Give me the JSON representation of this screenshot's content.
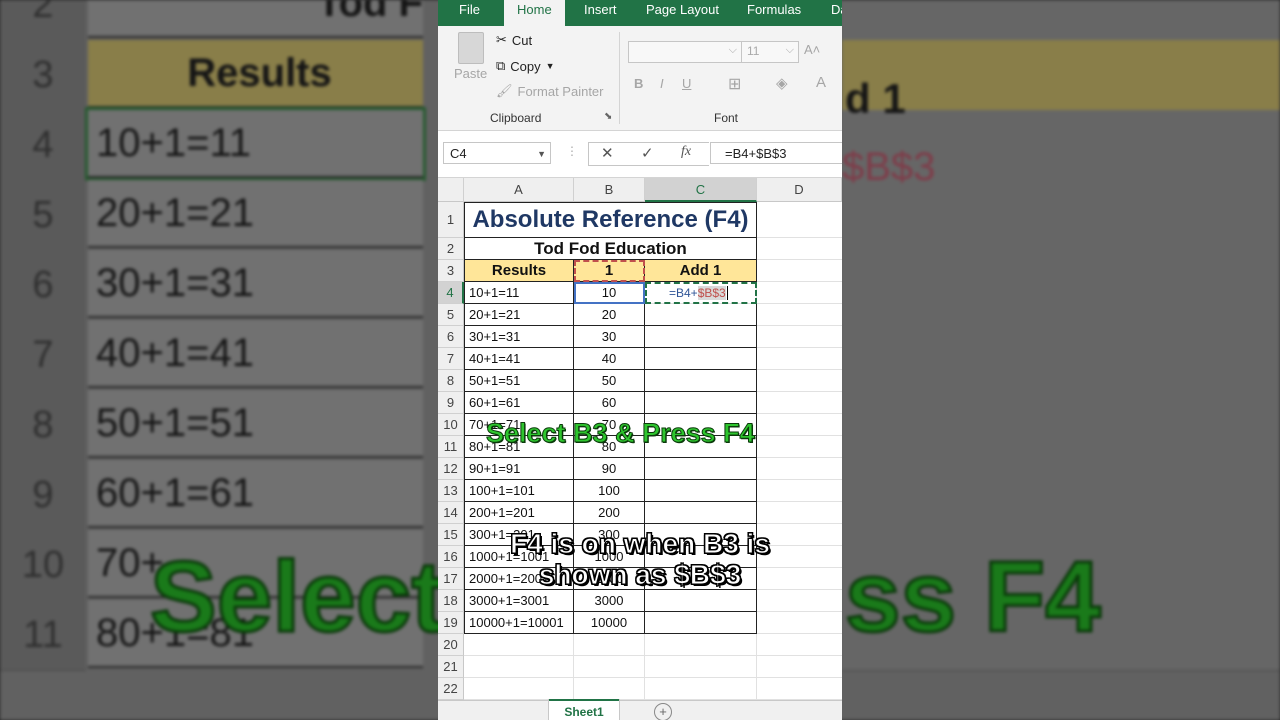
{
  "ribbon_tabs": [
    "File",
    "Home",
    "Insert",
    "Page Layout",
    "Formulas",
    "Da"
  ],
  "ribbon": {
    "paste": "Paste",
    "cut": "Cut",
    "copy": "Copy",
    "format_painter": "Format Painter",
    "clipboard_label": "Clipboard",
    "font_size": "11",
    "font_label": "Font",
    "bold": "B",
    "italic": "I",
    "underline": "U",
    "grow": "A˄",
    "shrink": "A˅",
    "font_color": "A"
  },
  "formula_bar": {
    "name_box": "C4",
    "cancel": "✕",
    "enter": "✓",
    "fx": "fx",
    "formula": "=B4+$B$3"
  },
  "columns": [
    "A",
    "B",
    "C",
    "D"
  ],
  "rows": [
    "1",
    "2",
    "3",
    "4",
    "5",
    "6",
    "7",
    "8",
    "9",
    "10",
    "11",
    "12",
    "13",
    "14",
    "15",
    "16",
    "17",
    "18",
    "19",
    "20",
    "21",
    "22"
  ],
  "sheet": {
    "title": "Absolute Reference (F4)",
    "subtitle": "Tod Fod Education",
    "headers": [
      "Results",
      "1",
      "Add 1"
    ],
    "edit_cell": {
      "ref_part": "=B4+",
      "abs_part": "$B$3"
    },
    "data": [
      [
        "10+1=11",
        "10"
      ],
      [
        "20+1=21",
        "20"
      ],
      [
        "30+1=31",
        "30"
      ],
      [
        "40+1=41",
        "40"
      ],
      [
        "50+1=51",
        "50"
      ],
      [
        "60+1=61",
        "60"
      ],
      [
        "70+1=71",
        "70"
      ],
      [
        "80+1=81",
        "80"
      ],
      [
        "90+1=91",
        "90"
      ],
      [
        "100+1=101",
        "100"
      ],
      [
        "200+1=201",
        "200"
      ],
      [
        "300+1=301",
        "300"
      ],
      [
        "1000+1=1001",
        "1000"
      ],
      [
        "2000+1=2001",
        "2000"
      ],
      [
        "3000+1=3001",
        "3000"
      ],
      [
        "10000+1=10001",
        "10000"
      ]
    ]
  },
  "sheet_tab": "Sheet1",
  "captions": {
    "top": "Select B3 & Press F4",
    "bottom": "F4 is on when B3 is shown as $B$3"
  },
  "background": {
    "rows": [
      {
        "num": "2",
        "text": "Tod F"
      },
      {
        "num": "3",
        "text": "Results"
      },
      {
        "num": "4",
        "text": "10+1=11"
      },
      {
        "num": "5",
        "text": "20+1=21"
      },
      {
        "num": "6",
        "text": "30+1=31"
      },
      {
        "num": "7",
        "text": "40+1=41"
      },
      {
        "num": "8",
        "text": "50+1=51"
      },
      {
        "num": "9",
        "text": "60+1=61"
      },
      {
        "num": "10",
        "text": "70+"
      },
      {
        "num": "11",
        "text": "80+1=81"
      }
    ],
    "right_texts": [
      "d 1",
      "$B$3"
    ],
    "caption_left": "Select",
    "caption_right": "ss F4"
  },
  "colors": {
    "excel_green": "#217346",
    "title_blue": "#1f3864",
    "header_fill": "#ffe699",
    "caption_green": "#2ec52e"
  }
}
